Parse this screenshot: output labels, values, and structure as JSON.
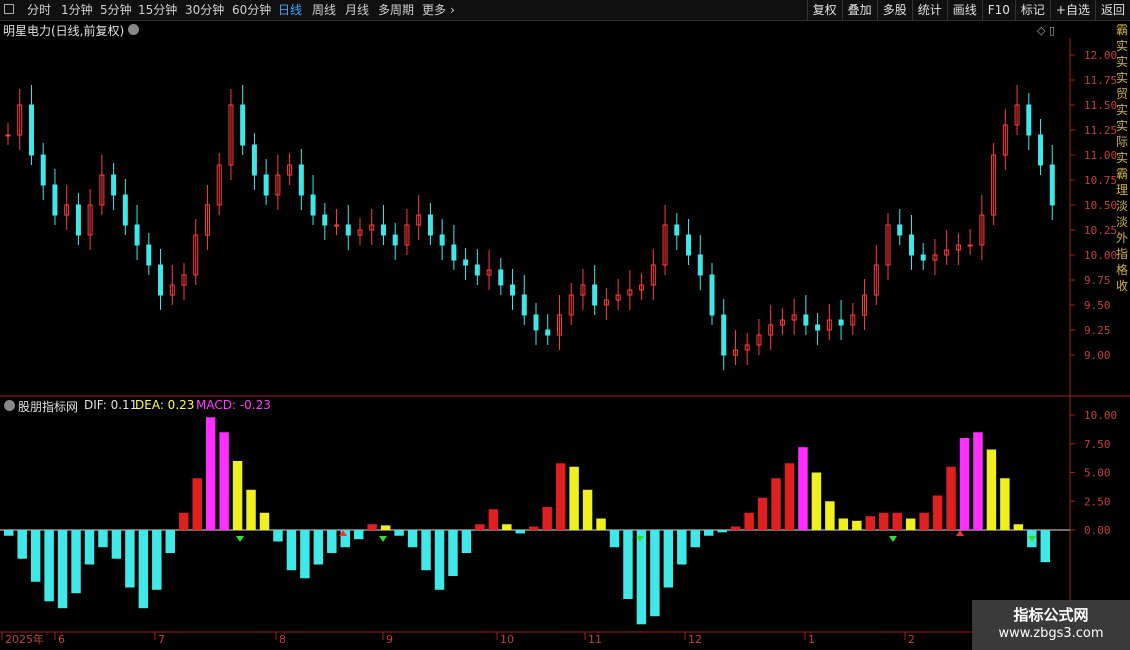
{
  "toolbar": {
    "periods": [
      "分时",
      "1分钟",
      "5分钟",
      "15分钟",
      "30分钟",
      "60分钟",
      "日线",
      "周线",
      "月线",
      "多周期",
      "更多"
    ],
    "active": "日线",
    "right_buttons": [
      "复权",
      "叠加",
      "多股",
      "统计",
      "画线",
      "F10",
      "标记",
      "+自选",
      "返回"
    ]
  },
  "stock": {
    "title": "明星电力(日线,前复权)"
  },
  "indicator": {
    "name": "股朋指标网",
    "dif_label": "DIF: 0.11",
    "dea_label": "DEA: 0.23",
    "macd_label": "MACD: -0.23"
  },
  "price_axis": {
    "ticks": [
      "12.00",
      "11.75",
      "11.50",
      "11.25",
      "11.00",
      "10.75",
      "10.50",
      "10.25",
      "10.00",
      "9.75",
      "9.50",
      "9.25",
      "9.00"
    ]
  },
  "macd_axis": {
    "ticks": [
      "10.00",
      "7.50",
      "5.00",
      "2.50",
      "0.00"
    ]
  },
  "dates": [
    "2025年",
    "6",
    "7",
    "8",
    "9",
    "10",
    "11",
    "12",
    "1",
    "2"
  ],
  "side_text": "霸实实实贸实实际实霸理淡淡外指格收",
  "watermark": {
    "line1": "指标公式网",
    "line2": "www.zbgs3.com"
  },
  "colors": {
    "up": "#ff3b3b",
    "down": "#3ee8e8",
    "axis": "#a02020",
    "neg_macd": "#40e8e8",
    "pos_red": "#e02020",
    "pos_yellow": "#f0f020",
    "pos_magenta": "#ff30ff"
  },
  "chart_data": {
    "type": "candlestick",
    "ylim": [
      8.8,
      12.2
    ],
    "closes": [
      11.2,
      11.5,
      11.0,
      10.7,
      10.4,
      10.5,
      10.2,
      10.5,
      10.8,
      10.6,
      10.3,
      10.1,
      9.9,
      9.6,
      9.7,
      9.8,
      10.2,
      10.5,
      10.9,
      11.5,
      11.1,
      10.8,
      10.6,
      10.8,
      10.9,
      10.6,
      10.4,
      10.3,
      10.3,
      10.2,
      10.25,
      10.3,
      10.2,
      10.1,
      10.3,
      10.4,
      10.2,
      10.1,
      9.95,
      9.9,
      9.8,
      9.85,
      9.7,
      9.6,
      9.4,
      9.25,
      9.2,
      9.4,
      9.6,
      9.7,
      9.5,
      9.55,
      9.6,
      9.65,
      9.7,
      9.9,
      10.3,
      10.2,
      10.0,
      9.8,
      9.4,
      9.0,
      9.05,
      9.1,
      9.2,
      9.3,
      9.35,
      9.4,
      9.3,
      9.25,
      9.35,
      9.3,
      9.4,
      9.6,
      9.9,
      10.3,
      10.2,
      10.0,
      9.95,
      10.0,
      10.05,
      10.1,
      10.1,
      10.4,
      11.0,
      11.3,
      11.5,
      11.2,
      10.9,
      10.5
    ],
    "macd": [
      -0.5,
      -2.5,
      -4.5,
      -6.2,
      -6.8,
      -5.5,
      -3.0,
      -1.5,
      -2.5,
      -5.0,
      -6.8,
      -5.2,
      -2.0,
      1.5,
      4.5,
      9.8,
      8.5,
      6.0,
      3.5,
      1.5,
      -1.0,
      -3.5,
      -4.2,
      -3.0,
      -2.0,
      -1.5,
      -0.8,
      0.5,
      0.4,
      -0.5,
      -1.5,
      -3.5,
      -5.2,
      -4.0,
      -2.0,
      0.5,
      1.8,
      0.5,
      -0.3,
      0.3,
      2.0,
      5.8,
      5.5,
      3.5,
      1.0,
      -1.5,
      -6.0,
      -8.2,
      -7.5,
      -5.0,
      -3.0,
      -1.5,
      -0.5,
      -0.2,
      0.3,
      1.5,
      2.8,
      4.5,
      5.8,
      7.2,
      5.0,
      2.5,
      1.0,
      0.8,
      1.2,
      1.5,
      1.5,
      1.0,
      1.5,
      3.0,
      5.5,
      8.0,
      8.5,
      7.0,
      4.5,
      0.5,
      -1.5,
      -2.8
    ],
    "date_labels": [
      "2025年",
      "6",
      "7",
      "8",
      "9",
      "10",
      "11",
      "12",
      "1",
      "2"
    ]
  }
}
